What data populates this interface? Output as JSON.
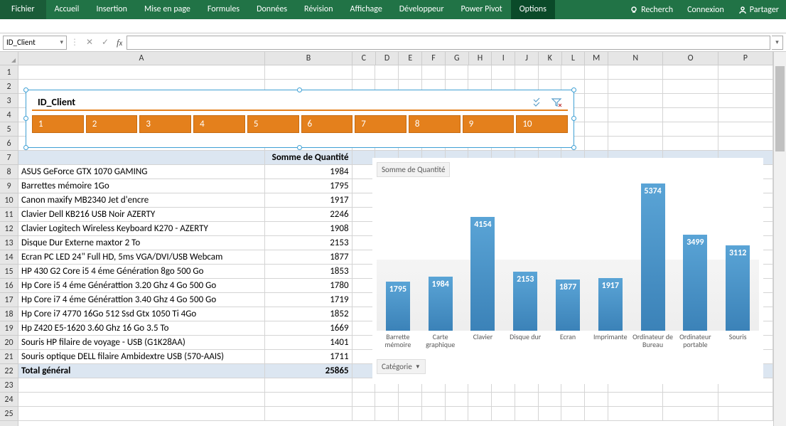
{
  "ribbon": {
    "file": "Fichier",
    "tabs": [
      "Accueil",
      "Insertion",
      "Mise en page",
      "Formules",
      "Données",
      "Révision",
      "Affichage",
      "Développeur",
      "Power Pivot",
      "Options"
    ],
    "active": "Options",
    "right": {
      "search": "Recherch",
      "signin": "Connexion",
      "share": "Partager"
    }
  },
  "namebox": {
    "value": "ID_Client"
  },
  "columns": [
    "A",
    "B",
    "C",
    "D",
    "E",
    "F",
    "G",
    "H",
    "I",
    "J",
    "K",
    "L",
    "M",
    "N",
    "O",
    "P"
  ],
  "rows": [
    1,
    2,
    3,
    4,
    5,
    6,
    7,
    8,
    9,
    10,
    11,
    12,
    13,
    14,
    15,
    16,
    17,
    18,
    19,
    20,
    21,
    22,
    23,
    24,
    25
  ],
  "slicer": {
    "title": "ID_Client",
    "items": [
      "1",
      "2",
      "3",
      "4",
      "5",
      "6",
      "7",
      "8",
      "9",
      "10"
    ]
  },
  "pivot": {
    "value_header": "Somme de Quantité",
    "rows": [
      {
        "label": "ASUS GeForce GTX 1070 GAMING",
        "value": 1984
      },
      {
        "label": "Barrettes mémoire 1Go",
        "value": 1795
      },
      {
        "label": "Canon maxify MB2340 Jet d'encre",
        "value": 1917
      },
      {
        "label": "Clavier Dell KB216 USB Noir AZERTY",
        "value": 2246
      },
      {
        "label": "Clavier Logitech Wireless Keyboard K270 - AZERTY",
        "value": 1908
      },
      {
        "label": "Disque Dur Externe maxtor 2 To",
        "value": 2153
      },
      {
        "label": "Ecran PC LED 24\" Full HD, 5ms VGA/DVI/USB Webcam",
        "value": 1877
      },
      {
        "label": "HP 430 G2 Core i5 4 éme Génération 8go 500 Go",
        "value": 1853
      },
      {
        "label": "Hp Core i5 4 éme Générattion 3.20 Ghz 4 Go 500 Go",
        "value": 1780
      },
      {
        "label": "Hp Core i7 4 éme Générattion 3.40 Ghz 4 Go 500 Go",
        "value": 1719
      },
      {
        "label": "Hp Core i7 4770 16Go 512 Ssd Gtx 1050 Ti 4Go",
        "value": 1852
      },
      {
        "label": "Hp Z420 E5-1620 3.60 Ghz 16 Go 3.5 To",
        "value": 1669
      },
      {
        "label": "Souris HP filaire de voyage - USB (G1K28AA)",
        "value": 1401
      },
      {
        "label": "Souris optique DELL filaire Ambidextre USB (570-AAIS)",
        "value": 1711
      }
    ],
    "grand_total_label": "Total général",
    "grand_total_value": 25865
  },
  "chart_title": "Somme  de Quantité",
  "category_button": "Catégorie",
  "chart_data": {
    "type": "bar",
    "title": "Somme de Quantité",
    "categories": [
      "Barrette mémoire",
      "Carte graphique",
      "Clavier",
      "Disque dur",
      "Ecran",
      "Imprimante",
      "Ordinateur de Bureau",
      "Ordinateur portable",
      "Souris"
    ],
    "values": [
      1795,
      1984,
      4154,
      2153,
      1877,
      1917,
      5374,
      3499,
      3112
    ],
    "xlabel": "Catégorie",
    "ylabel": "",
    "ylim": [
      0,
      5500
    ]
  }
}
